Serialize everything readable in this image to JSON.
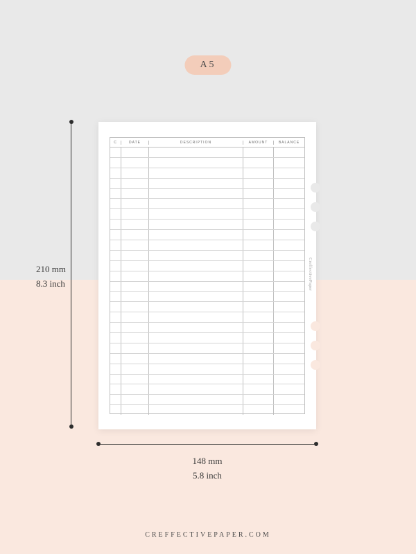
{
  "badge": {
    "label": "A5"
  },
  "dimensions": {
    "height_mm": "210 mm",
    "height_in": "8.3 inch",
    "width_mm": "148 mm",
    "width_in": "5.8 inch"
  },
  "ledger": {
    "columns": {
      "c": "C",
      "date": "DATE",
      "description": "DESCRIPTION",
      "amount": "AMOUNT",
      "balance": "BALANCE"
    },
    "row_count": 26
  },
  "watermark": "CreffectivePaper",
  "footer": "CREFFECTIVEPAPER.COM"
}
